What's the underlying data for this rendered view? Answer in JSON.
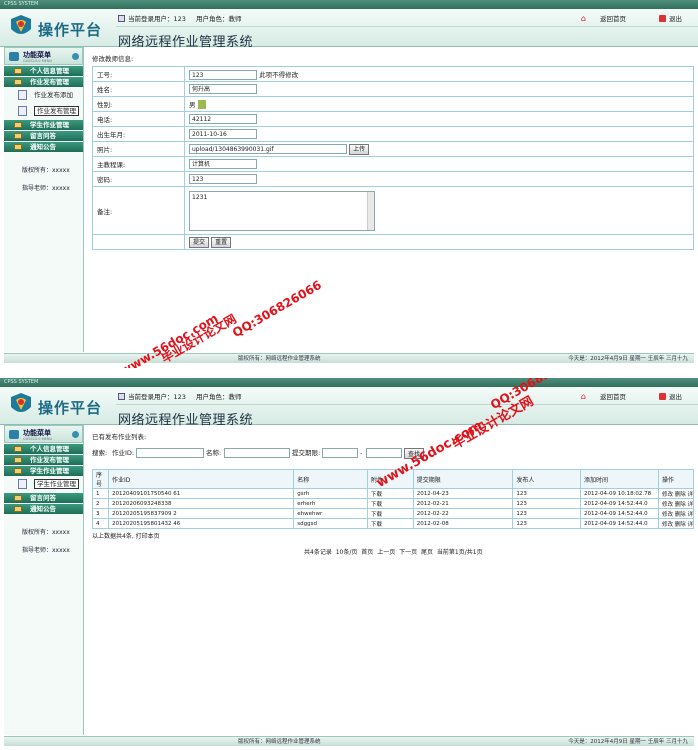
{
  "window_title": "CPSS SYSTEM",
  "logo_text": "操作平台",
  "header": {
    "user_label": "当前登录用户：123",
    "role_label": "用户角色：教师",
    "home_label": "返回首页",
    "exit_label": "退出",
    "system_title": "网络远程作业管理系统"
  },
  "sidebar": {
    "menu_title": "功能菜单",
    "menu_subtitle": "GUSS10.0 MENU",
    "groups": [
      "个人信息管理",
      "作业发布管理",
      "学生作业管理",
      "留言问答",
      "通知公告"
    ],
    "sub_items_p1": [
      "作业发布添加",
      "作业发布管理"
    ],
    "sub_items_p2": [
      "学生作业管理"
    ],
    "copyright": "版权所有：xxxxx",
    "advisor": "指导老师：xxxxx"
  },
  "edit_form": {
    "title": "修改教师信息:",
    "fields": {
      "id_label": "工号:",
      "id_value": "123",
      "id_note": "此项不得修改",
      "name_label": "姓名:",
      "name_value": "何升高",
      "gender_label": "性别:",
      "gender_value": "男",
      "phone_label": "电话:",
      "phone_value": "42112",
      "birth_label": "出生年月:",
      "birth_value": "2011-10-16",
      "photo_label": "照片:",
      "photo_value": "upload/1304863990031.gif",
      "upload_btn": "上传",
      "course_label": "主教程课:",
      "course_value": "计算机",
      "password_label": "密码:",
      "password_value": "123",
      "remark_label": "备注:",
      "remark_value": "1231"
    },
    "submit_btn": "提交",
    "reset_btn": "重置"
  },
  "list": {
    "title": "已有发布作业列表:",
    "search_label": "搜索:",
    "f_id_label": "作业ID:",
    "f_name_label": "名称:",
    "f_date_label": "提交期限:",
    "f_search_btn": "查找",
    "columns": [
      "序号",
      "作业ID",
      "名称",
      "附件",
      "提交期限",
      "发布人",
      "添加时间",
      "操作"
    ],
    "rows": [
      [
        "1",
        "20120409101750540 61",
        "gsrh",
        "下载",
        "2012-04-23",
        "123",
        "2012-04-09 10:18:02.78",
        "修改 删除 详"
      ],
      [
        "2",
        "20120206093248338",
        "erherh",
        "下载",
        "2012-02-21",
        "123",
        "2012-04-09 14:52:44.0",
        "修改 删除 详"
      ],
      [
        "3",
        "20120205195837909 2",
        "ehwehwr",
        "下载",
        "2012-02-22",
        "123",
        "2012-04-09 14:52:44.0",
        "修改 删除 详"
      ],
      [
        "4",
        "20120205195801432 46",
        "sdggsd",
        "下载",
        "2012-02-08",
        "123",
        "2012-04-09 14:52:44.0",
        "修改 删除 详"
      ]
    ],
    "summary": "以上数据共4条, 打印本页",
    "pager": "共4条记录  10条/页  首页  上一页  下一页  尾页  当前第1页/共1页"
  },
  "footer": {
    "copyright": "版权所有：网络远程作业管理系统",
    "date": "今天是：2012年4月9日 星期一 壬辰年 三月十九"
  },
  "watermark": {
    "site": "www.56doc.com",
    "qq": "QQ:306826066",
    "brand": "毕业设计论文网"
  },
  "colors": {
    "accent": "#2a7a64",
    "watermark": "#e1121a",
    "table_border": "#9fcfe0"
  }
}
